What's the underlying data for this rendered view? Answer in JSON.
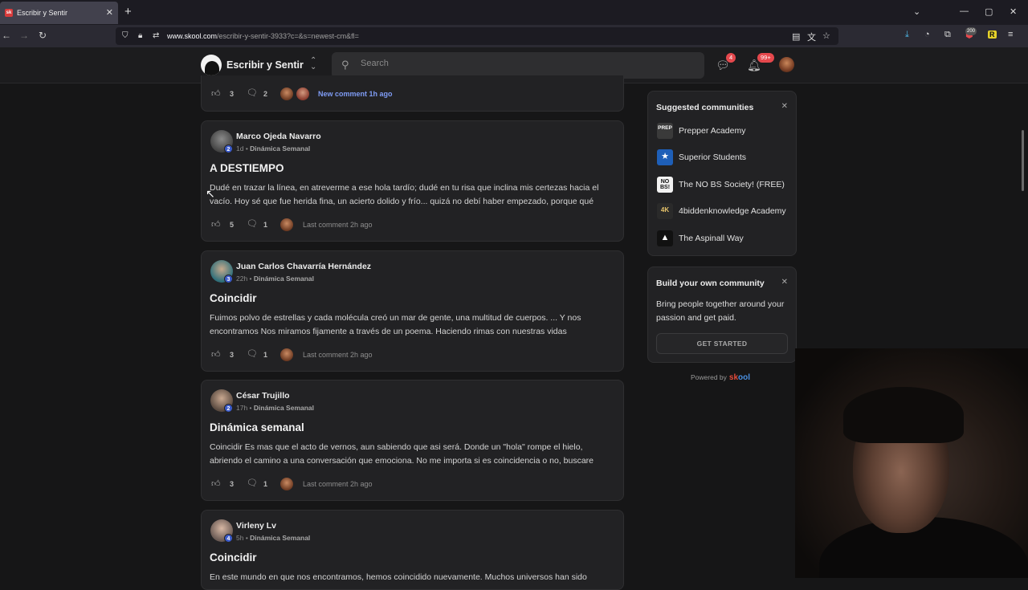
{
  "browser": {
    "tab_title": "Escribir y Sentir",
    "tab_favicon": "sk",
    "url_domain": "www.skool.com",
    "url_path": "/escribir-y-sentir-3933?c=&s=newest-cm&fl=",
    "ext_badge": "200"
  },
  "header": {
    "community_name": "Escribir y Sentir",
    "search_placeholder": "Search",
    "chat_badge": "4",
    "notif_badge": "99+"
  },
  "top_card": {
    "likes": "3",
    "comments": "2",
    "activity": "New comment 1h ago"
  },
  "posts": [
    {
      "author": "Marco Ojeda Navarro",
      "level": "2",
      "time": "1d",
      "category": "Dinámica Semanal",
      "title": "A DESTIEMPO",
      "body": "Dudé en trazar la línea, en atreverme a ese hola tardío; dudé en tu risa que inclina mis certezas hacia el vacío. Hoy sé que fue herida fina, un acierto dolido y frío... quizá no debí haber empezado, porque qué",
      "likes": "5",
      "comments": "1",
      "activity": "Last comment 2h ago"
    },
    {
      "author": "Juan Carlos Chavarría Hernández",
      "level": "3",
      "time": "22h",
      "category": "Dinámica Semanal",
      "title": "Coincidir",
      "body": "Fuimos polvo de estrellas y cada molécula creó un mar de gente, una multitud de cuerpos. ... Y nos encontramos Nos miramos fijamente a través de un poema. Haciendo rimas con nuestras vidas",
      "likes": "3",
      "comments": "1",
      "activity": "Last comment 2h ago"
    },
    {
      "author": "César Trujillo",
      "level": "2",
      "time": "17h",
      "category": "Dinámica Semanal",
      "title": "Dinámica semanal",
      "body": "Coincidir Es mas que el acto de vernos, aun sabiendo que asi será. Donde un \"hola\" rompe el hielo, abriendo el camino a una conversación que emociona. No me importa si es coincidencia o no, buscare",
      "likes": "3",
      "comments": "1",
      "activity": "Last comment 2h ago"
    },
    {
      "author": "Virleny Lv",
      "level": "4",
      "time": "5h",
      "category": "Dinámica Semanal",
      "title": "Coincidir",
      "body": "En este mundo en que nos encontramos, hemos coincidido nuevamente. Muchos universos han sido"
    }
  ],
  "suggested": {
    "title": "Suggested communities",
    "items": [
      {
        "name": "Prepper Academy",
        "icon": "prepper-academy-logo",
        "abbr": "PREP",
        "color": "#3a3a3a"
      },
      {
        "name": "Superior Students",
        "icon": "superior-students-logo",
        "abbr": "★",
        "color": "#1e5fb8"
      },
      {
        "name": "The NO BS Society! (FREE)",
        "icon": "nobs-logo",
        "abbr": "NO BS!",
        "color": "#f2f2f2"
      },
      {
        "name": "4biddenknowledge Academy",
        "icon": "4k-logo",
        "abbr": "4K",
        "color": "#2a2a2a"
      },
      {
        "name": "The Aspinall Way",
        "icon": "aspinall-logo",
        "abbr": "▲",
        "color": "#111111"
      }
    ]
  },
  "build": {
    "title": "Build your own community",
    "text": "Bring people together around your passion and get paid.",
    "cta": "GET STARTED"
  },
  "powered": {
    "label": "Powered by",
    "brand_a": "sk",
    "brand_b": "ool"
  }
}
